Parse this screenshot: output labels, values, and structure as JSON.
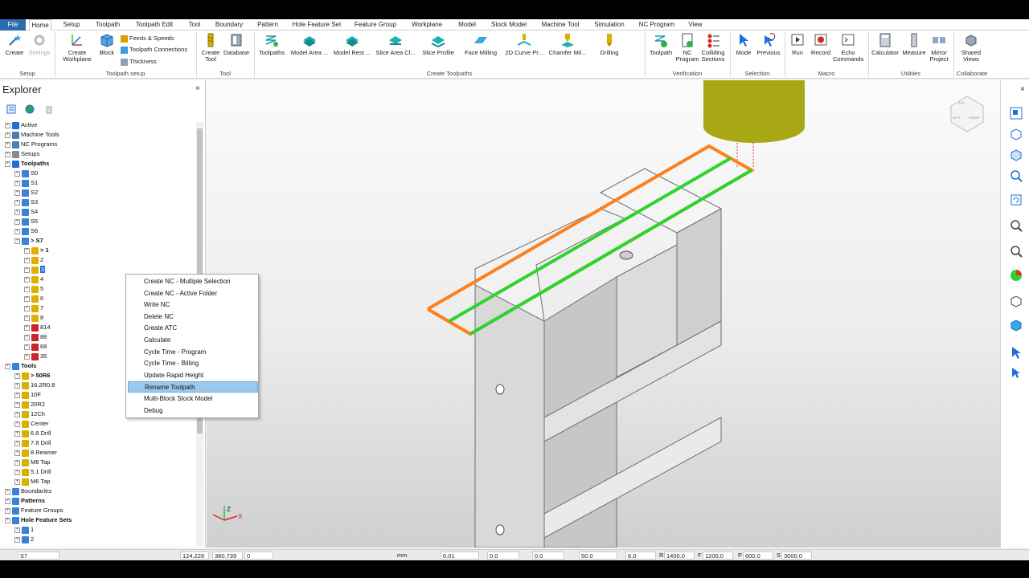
{
  "menu_tabs": [
    "File",
    "Home",
    "Setup",
    "Toolpath",
    "Toolpath Edit",
    "Tool",
    "Boundary",
    "Pattern",
    "Hole Feature Set",
    "Feature Group",
    "Workplane",
    "Model",
    "Stock Model",
    "Machine Tool",
    "Simulation",
    "NC Program",
    "View"
  ],
  "ribbon": {
    "create": "Create",
    "settings": "Settings",
    "create_workplane": "Create Workplane",
    "block": "Block",
    "feeds_speeds": "Feeds & Speeds",
    "toolpath_connections": "Toolpath Connections",
    "thickness": "Thickness",
    "create_tool": "Create Tool",
    "database": "Database",
    "toolpaths": "Toolpaths",
    "model_area": "Model Area ...",
    "model_rest": "Model Rest ...",
    "slice_area": "Slice Area Cl...",
    "slice_profile": "Slice Profile",
    "face_milling": "Face Milling",
    "curve_2d": "2D Curve Pr...",
    "chamfer": "Chamfer Mil...",
    "drilling": "Drilling",
    "toolpath_ver": "Toolpath",
    "nc_program": "NC Program",
    "colliding": "Colliding Sections",
    "mode": "Mode",
    "previous": "Previous",
    "run": "Run",
    "record": "Record",
    "echo": "Echo Commands",
    "calculator": "Calculator",
    "measure": "Measure",
    "mirror": "Mirror Project",
    "shared_views": "Shared Views",
    "groups": {
      "setup": "Setup",
      "toolpath_setup": "Toolpath setup",
      "tool": "Tool",
      "create_toolpaths": "Create Toolpaths",
      "verification": "Verification",
      "selection": "Selection",
      "macro": "Macro",
      "utilities": "Utilities",
      "collaborate": "Collaborate"
    }
  },
  "explorer": {
    "title": "Explorer",
    "close": "×",
    "tree": [
      {
        "label": "Active",
        "bold": false
      },
      {
        "label": "Machine Tools",
        "bold": false
      },
      {
        "label": "NC Programs",
        "bold": false
      },
      {
        "label": "Setups",
        "bold": false
      },
      {
        "label": "Toolpaths",
        "bold": true
      },
      {
        "label": "S0",
        "bold": false
      },
      {
        "label": "S1",
        "bold": false
      },
      {
        "label": "S2",
        "bold": false
      },
      {
        "label": "S3",
        "bold": false
      },
      {
        "label": "S4",
        "bold": false
      },
      {
        "label": "S5",
        "bold": false
      },
      {
        "label": "S6",
        "bold": false
      },
      {
        "label": "> S7",
        "bold": true
      },
      {
        "label": "> 1",
        "bold": true
      },
      {
        "label": "2",
        "bold": false
      },
      {
        "label": "3",
        "bold": false
      },
      {
        "label": "4",
        "bold": false
      },
      {
        "label": "5",
        "bold": false
      },
      {
        "label": "6",
        "bold": false
      },
      {
        "label": "7",
        "bold": false
      },
      {
        "label": "8",
        "bold": false
      },
      {
        "label": "814",
        "bold": false
      },
      {
        "label": "88",
        "bold": false
      },
      {
        "label": "68",
        "bold": false
      },
      {
        "label": "35",
        "bold": false
      },
      {
        "label": "Tools",
        "bold": true
      },
      {
        "label": "> 50R6",
        "bold": true
      },
      {
        "label": "16.2R0.8",
        "bold": false
      },
      {
        "label": "10F",
        "bold": false
      },
      {
        "label": "20R2",
        "bold": false
      },
      {
        "label": "12Ch",
        "bold": false
      },
      {
        "label": "Center",
        "bold": false
      },
      {
        "label": "6.8 Drill",
        "bold": false
      },
      {
        "label": "7.8 Drill",
        "bold": false
      },
      {
        "label": "8 Reamer",
        "bold": false
      },
      {
        "label": "M8 Tap",
        "bold": false
      },
      {
        "label": "5.1 Drill",
        "bold": false
      },
      {
        "label": "M6 Tap",
        "bold": false
      },
      {
        "label": "Boundaries",
        "bold": false
      },
      {
        "label": "Patterns",
        "bold": true
      },
      {
        "label": "Feature Groups",
        "bold": false
      },
      {
        "label": "Hole Feature Sets",
        "bold": true
      },
      {
        "label": "1",
        "bold": false
      },
      {
        "label": "2",
        "bold": false
      }
    ]
  },
  "context_menu": {
    "items": [
      "Create NC - Multiple Selection",
      "Create NC - Active Folder",
      "Write NC",
      "Delete NC",
      "Create ATC",
      "Calculate",
      "Cycle Time - Program",
      "Cycle Time - Billing",
      "Update Rapid Height",
      "Rename Toolpath",
      "Multi-Block Stock Model",
      "Debug"
    ],
    "highlighted": "Rename Toolpath"
  },
  "viewport": {
    "cube_top": "TOP",
    "cube_left": "LEFT",
    "cube_front": "FRONT",
    "triad_z": "Z",
    "triad_x": "X",
    "close": "×"
  },
  "status": {
    "current": "S7",
    "x": "124.226",
    "y": "380.739",
    "z": "0",
    "unit": "mm",
    "tolerance": "0.01",
    "thickness": "0.0",
    "axial": "0.0",
    "diameter": "50.0",
    "stepover": "6.0",
    "r_label": "R",
    "r": "1400.0",
    "f_label": "F",
    "f": "1200.0",
    "p_label": "P",
    "p": "600.0",
    "s_label": "S",
    "s": "3000.0"
  },
  "colors": {
    "toolpath_green": "#2fd32f",
    "toolpath_orange": "#ff7f1a",
    "tool_olive": "#a9a91a",
    "selection_blue": "#1e6fd9",
    "menu_highlight": "#99c9ef"
  }
}
